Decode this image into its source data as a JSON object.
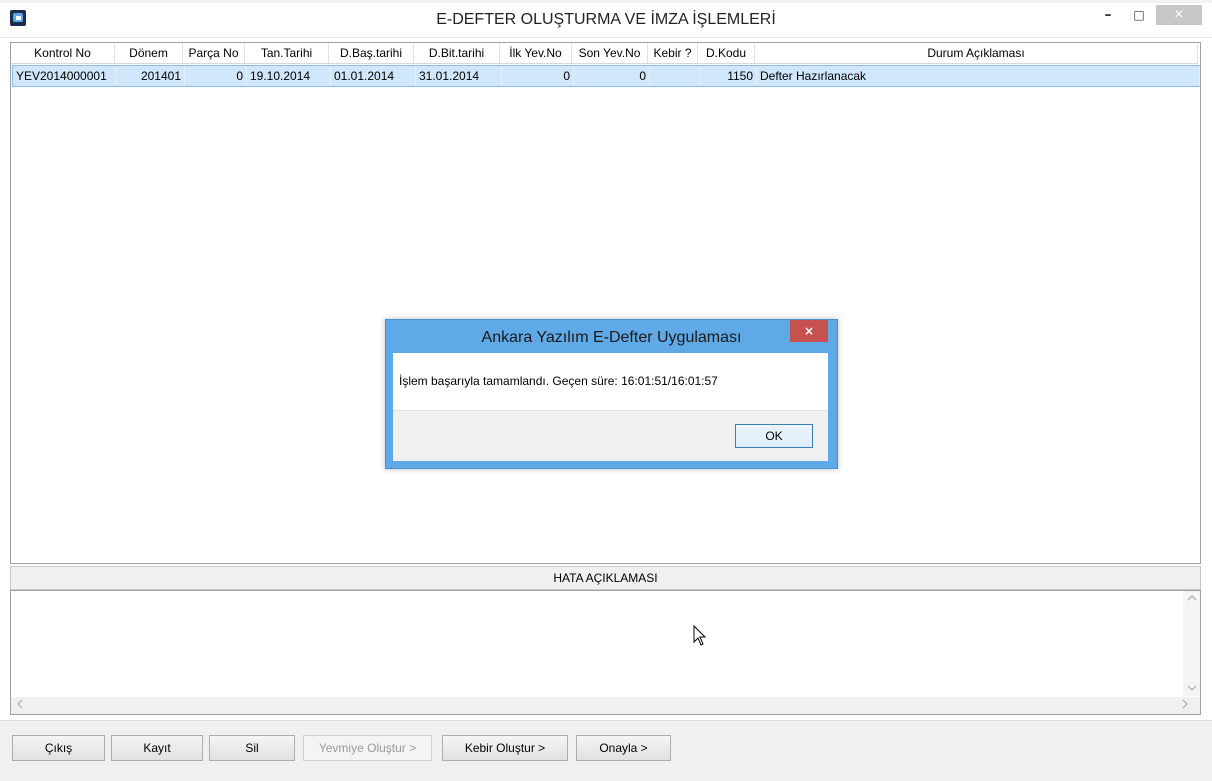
{
  "window": {
    "title": "E-DEFTER OLUŞTURMA VE İMZA İŞLEMLERİ",
    "minimize_label": "–",
    "maximize_label": "□",
    "close_label": "×"
  },
  "grid": {
    "columns": [
      "Kontrol No",
      "Dönem",
      "Parça No",
      "Tan.Tarihi",
      "D.Baş.tarihi",
      "D.Bit.tarihi",
      "İlk Yev.No",
      "Son Yev.No",
      "Kebir ?",
      "D.Kodu",
      "Durum Açıklaması"
    ],
    "rows": [
      [
        "YEV2014000001",
        "201401",
        "0",
        "19.10.2014",
        "01.01.2014",
        "31.01.2014",
        "0",
        "0",
        "",
        "1150",
        "Defter Hazırlanacak"
      ]
    ]
  },
  "error_panel": {
    "title": "HATA AÇIKLAMASI",
    "content": ""
  },
  "buttons": {
    "exit": "Çıkış",
    "save": "Kayıt",
    "delete": "Sil",
    "create_journal": "Yevmiye Oluştur >",
    "create_ledger": "Kebir Oluştur >",
    "approve": "Onayla >"
  },
  "dialog": {
    "title": "Ankara Yazılım E-Defter Uygulaması",
    "message": "İşlem başarıyla tamamlandı. Geçen süre: 16:01:51/16:01:57",
    "ok": "OK",
    "close_label": "×"
  },
  "icons": [
    "app-icon",
    "mouse-cursor-icon",
    "scroll-up-icon",
    "scroll-down-icon",
    "scroll-left-icon",
    "scroll-right-icon"
  ],
  "colors": {
    "selection": "#cfe6fb",
    "dialog_frame": "#5ea9e6",
    "close_red": "#c75050"
  }
}
